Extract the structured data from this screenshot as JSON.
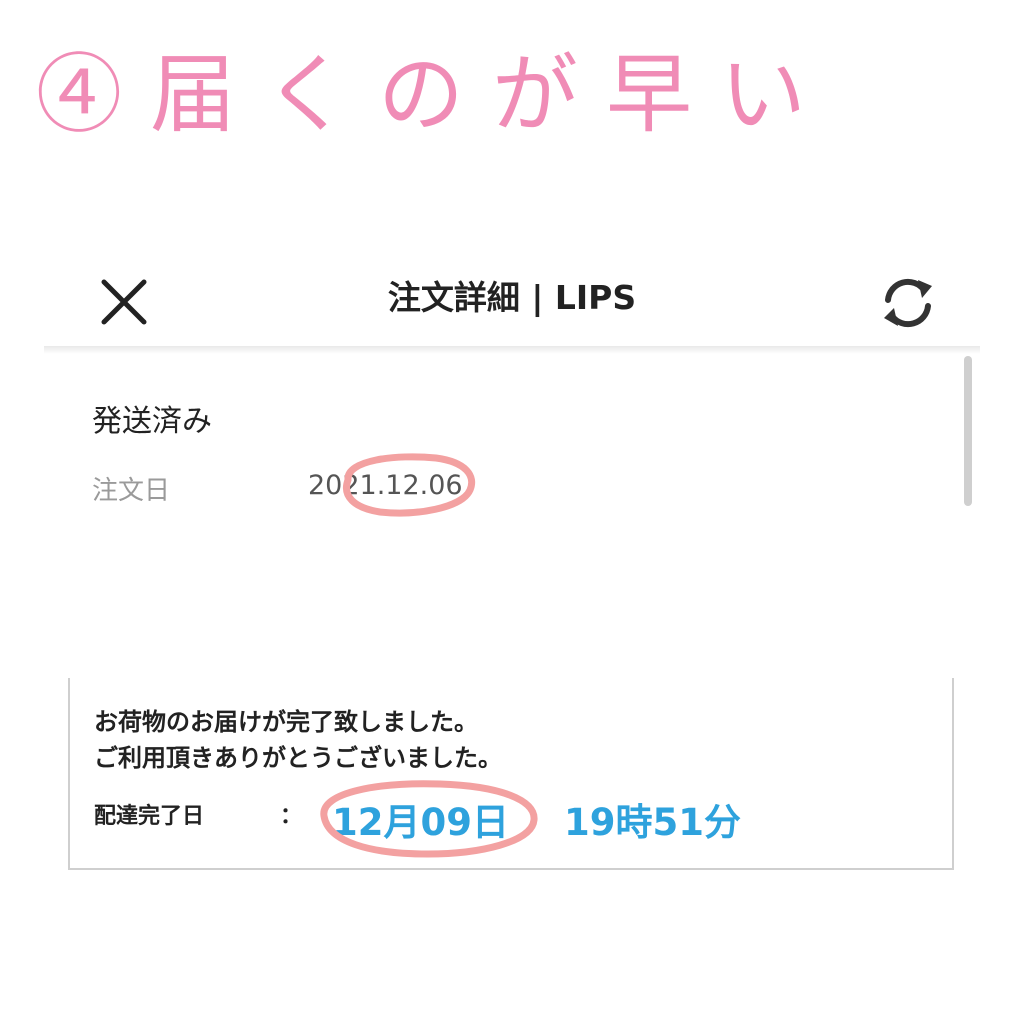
{
  "headline": "④届くのが早い",
  "appbar": {
    "title": "注文詳細 | LIPS",
    "close_icon": "close-icon",
    "refresh_icon": "refresh-icon"
  },
  "order": {
    "status": "発送済み",
    "date_label": "注文日",
    "date_value": "2021.12.06"
  },
  "delivery": {
    "message_line1": "お荷物のお届けが完了致しました。",
    "message_line2": "ご利用頂きありがとうございました。",
    "completed_label": "配達完了日",
    "separator": "：",
    "completed_date": "12月09日",
    "completed_time": "19時51分"
  },
  "colors": {
    "headline": "#f08cb6",
    "highlight_circle": "#f3a1a1",
    "delivery_value": "#2ea2dd"
  }
}
